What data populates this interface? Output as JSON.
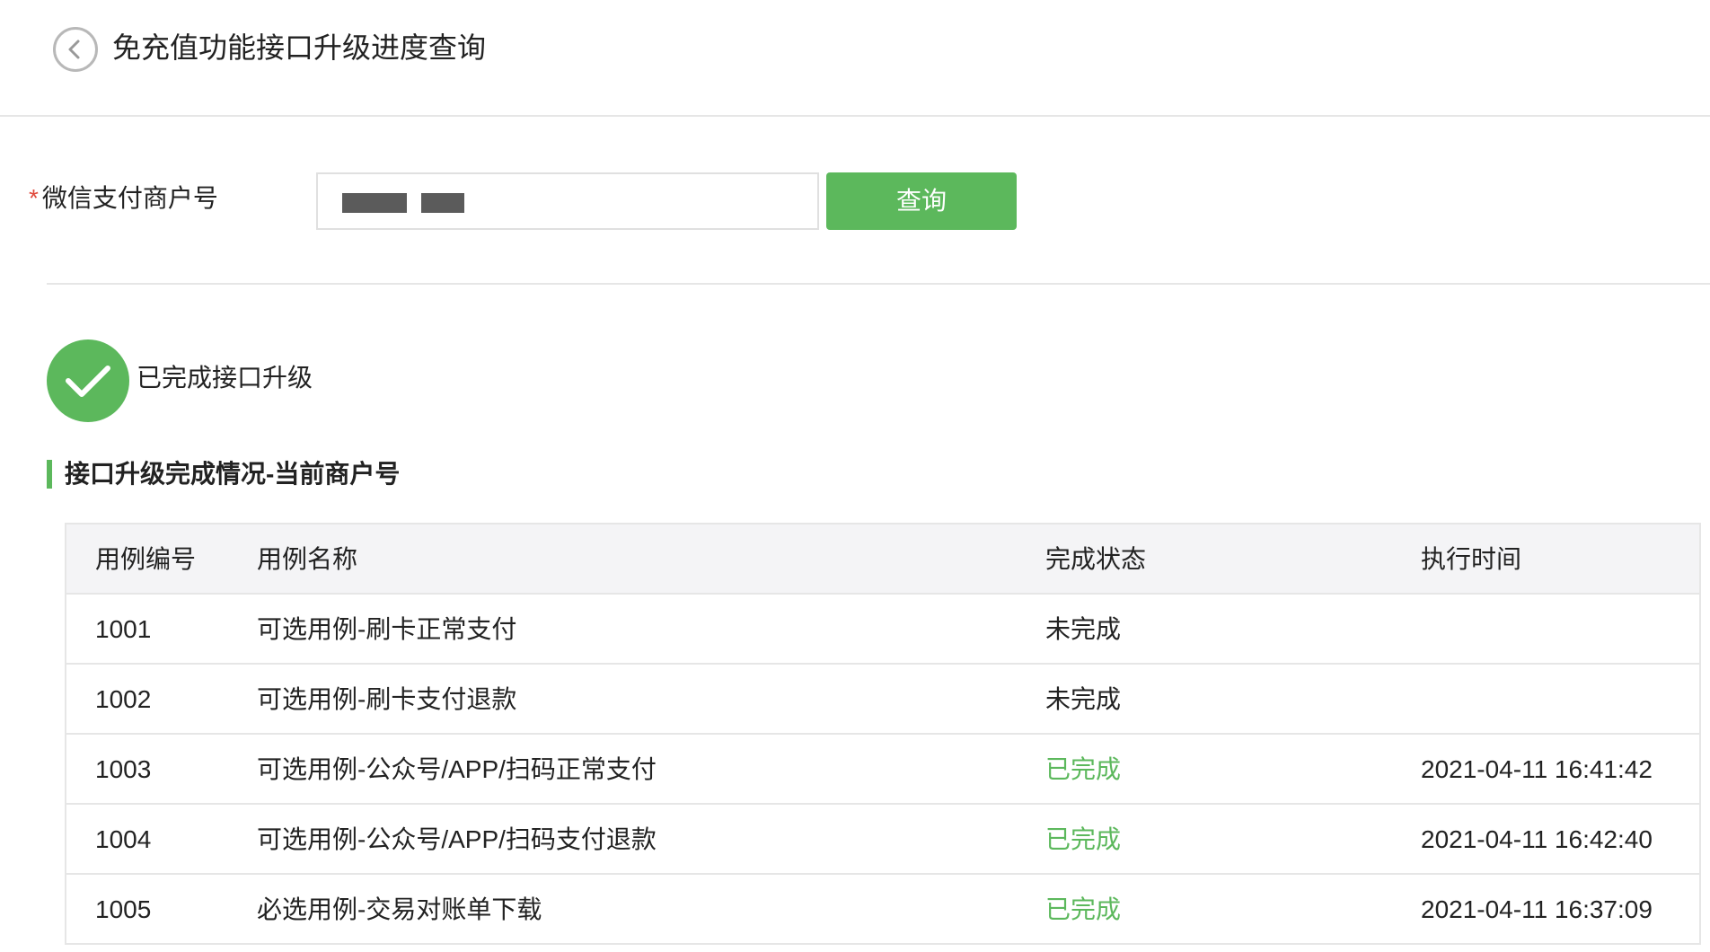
{
  "header": {
    "title": "免充值功能接口升级进度查询",
    "back_icon": "chevron-left-circle-icon"
  },
  "form": {
    "required_mark": "*",
    "label": "微信支付商户号",
    "query_label": "查询",
    "accent": "#5cb85c"
  },
  "status": {
    "icon": "check-circle-icon",
    "text": "已完成接口升级"
  },
  "section": {
    "title": "接口升级完成情况-当前商户号"
  },
  "table": {
    "headers": [
      "用例编号",
      "用例名称",
      "完成状态",
      "执行时间"
    ],
    "rows": [
      {
        "id": "1001",
        "name": "可选用例-刷卡正常支付",
        "status": "未完成",
        "time": ""
      },
      {
        "id": "1002",
        "name": "可选用例-刷卡支付退款",
        "status": "未完成",
        "time": ""
      },
      {
        "id": "1003",
        "name": "可选用例-公众号/APP/扫码正常支付",
        "status": "已完成",
        "time": "2021-04-11 16:41:42"
      },
      {
        "id": "1004",
        "name": "可选用例-公众号/APP/扫码支付退款",
        "status": "已完成",
        "time": "2021-04-11 16:42:40"
      },
      {
        "id": "1005",
        "name": "必选用例-交易对账单下载",
        "status": "已完成",
        "time": "2021-04-11 16:37:09"
      }
    ]
  },
  "colors": {
    "done": "#5cb85c",
    "pending": "#222222"
  }
}
